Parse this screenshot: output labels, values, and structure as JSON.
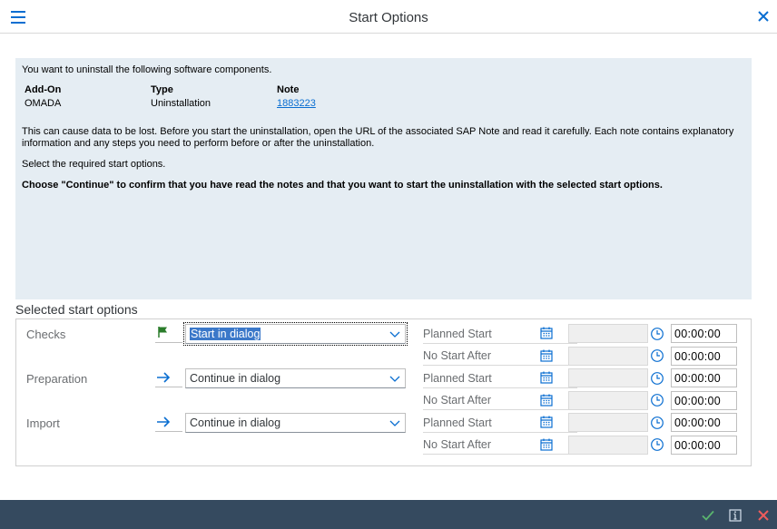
{
  "window": {
    "title": "Start Options"
  },
  "info": {
    "intro": "You want to uninstall the following software components.",
    "columns": {
      "addon": "Add-On",
      "type": "Type",
      "note": "Note"
    },
    "row": {
      "addon": "OMADA",
      "type": "Uninstallation",
      "note": "1883223"
    },
    "warning": "This can cause data to be lost. Before you start the uninstallation, open the URL of the associated SAP Note and read it carefully. Each note contains explanatory information and any steps you need to perform before or after the uninstallation.",
    "select_hint": "Select the required start options.",
    "confirm": "Choose \"Continue\" to confirm that you have read the notes and that you want to start the uninstallation with the selected start options."
  },
  "options": {
    "title": "Selected start options",
    "phases": [
      {
        "label": "Checks",
        "icon": "flag-icon",
        "mode": "Start in dialog",
        "planned_label": "Planned Start",
        "planned_time": "00:00:00",
        "nostart_label": "No Start After",
        "nostart_time": "00:00:00"
      },
      {
        "label": "Preparation",
        "icon": "arrow-right-icon",
        "mode": "Continue in dialog",
        "planned_label": "Planned Start",
        "planned_time": "00:00:00",
        "nostart_label": "No Start After",
        "nostart_time": "00:00:00"
      },
      {
        "label": "Import",
        "icon": "arrow-right-icon",
        "mode": "Continue in dialog",
        "planned_label": "Planned Start",
        "planned_time": "00:00:00",
        "nostart_label": "No Start After",
        "nostart_time": "00:00:00"
      }
    ]
  },
  "footer": {
    "buttons": [
      "confirm-check-icon",
      "info-icon",
      "cancel-x-icon"
    ]
  },
  "colors": {
    "accent": "#0a6ed1",
    "footer": "#354a5f",
    "panel": "#e5edf3",
    "confirm": "#5ab56e",
    "cancel": "#ee5c5c"
  }
}
